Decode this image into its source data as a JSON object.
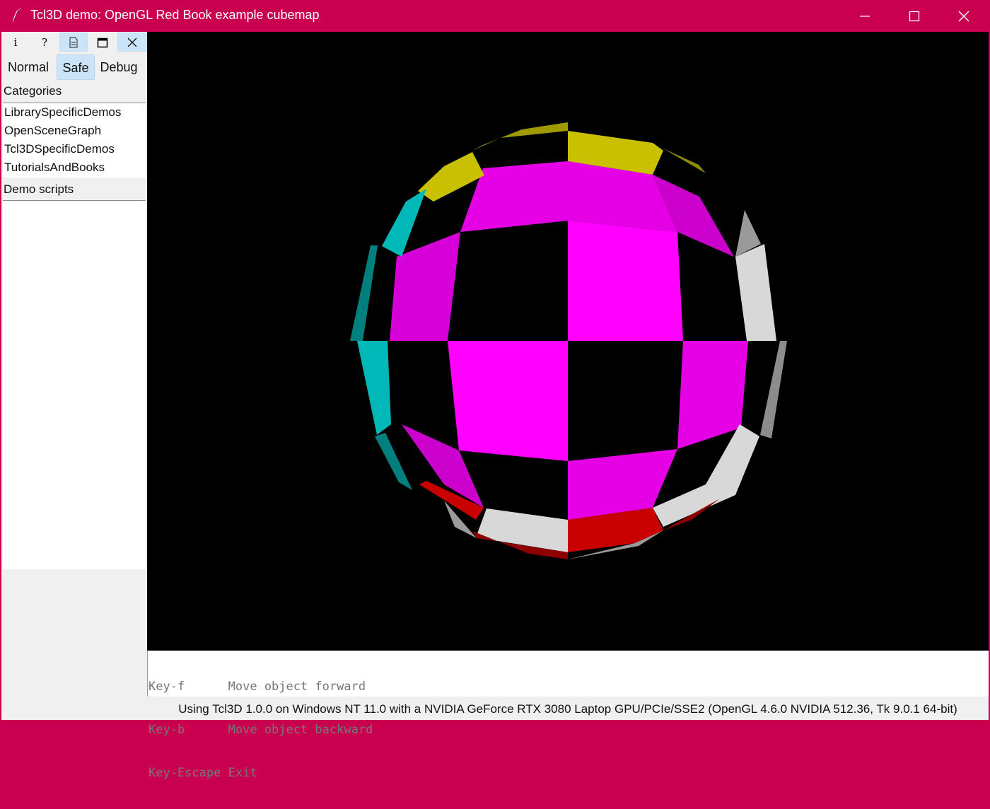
{
  "window": {
    "title": "Tcl3D demo: OpenGL Red Book example cubemap",
    "accent_color": "#c8004f"
  },
  "toolbar": {
    "buttons": [
      {
        "icon": "info-icon",
        "glyph": "i"
      },
      {
        "icon": "help-icon",
        "glyph": "?"
      },
      {
        "icon": "document-icon"
      },
      {
        "icon": "window-icon"
      },
      {
        "icon": "close-icon"
      }
    ]
  },
  "modes": {
    "normal": "Normal",
    "safe": "Safe",
    "debug": "Debug",
    "selected": "Safe"
  },
  "categories": {
    "label": "Categories",
    "items": [
      "LibrarySpecificDemos",
      "OpenSceneGraph",
      "Tcl3DSpecificDemos",
      "TutorialsAndBooks"
    ]
  },
  "demo_scripts": {
    "label": "Demo scripts",
    "items": []
  },
  "key_help": [
    {
      "key": "Key-f",
      "action": "Move object forward"
    },
    {
      "key": "Key-b",
      "action": "Move object backward"
    },
    {
      "key": "Key-Escape",
      "action": "Exit"
    }
  ],
  "status": "Using Tcl3D 1.0.0 on Windows NT 11.0 with a NVIDIA GeForce RTX 3080 Laptop GPU/PCIe/SSE2 (OpenGL 4.6.0 NVIDIA 512.36, Tk 9.0.1 64-bit)",
  "scene": {
    "colors": {
      "magenta": "#ff00ff",
      "yellow": "#c8c000",
      "cyan": "#00b8b8",
      "white": "#d8d8d8",
      "red": "#c80000"
    }
  }
}
